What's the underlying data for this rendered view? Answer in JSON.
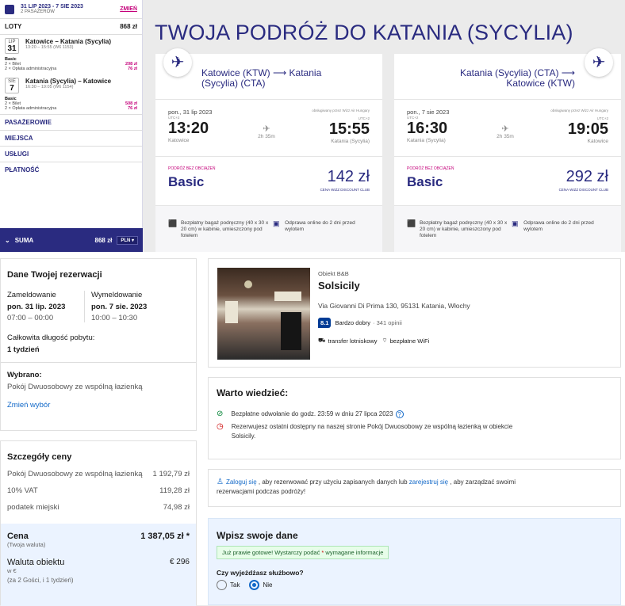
{
  "flight_summary": {
    "dates": "31 LIP 2023 - 7 SIE 2023",
    "passengers": "2 PASAŻERÓW",
    "change": "ZMIEŃ",
    "flights_label": "LOTY",
    "flights_total": "868 zł",
    "legs": [
      {
        "month": "LIP",
        "day": "31",
        "route": "Katowice – Katania (Sycylia)",
        "times": "13:20 – 15:55 (W6 1153)",
        "fare": "Basic",
        "items": [
          {
            "label": "2 × Bilet",
            "value": "208 zł"
          },
          {
            "label": "2 × Opłata administracyjna",
            "value": "76 zł"
          }
        ]
      },
      {
        "month": "SIE",
        "day": "7",
        "route": "Katania (Sycylia) – Katowice",
        "times": "16:30 – 19:05 (W6 1154)",
        "fare": "Basic",
        "items": [
          {
            "label": "2 × Bilet",
            "value": "508 zł"
          },
          {
            "label": "2 × Opłata administracyjna",
            "value": "76 zł"
          }
        ]
      }
    ],
    "sections": [
      "PASAŻEROWIE",
      "MIEJSCA",
      "USŁUGI",
      "PŁATNOŚĆ"
    ],
    "sum_label": "SUMA",
    "sum_value": "868 zł",
    "currency": "PLN"
  },
  "trip": {
    "title": "TWOJA PODRÓŻ DO KATANIA (SYCYLIA)",
    "cards": [
      {
        "route_a": "Katowice (KTW) ⟶ Katania",
        "route_b": "(Sycylia) (CTA)",
        "date": "pon., 31 lip 2023",
        "operator": "obsługiwany przez Wizz Air Hungary",
        "dep_utc": "UTC+2",
        "arr_utc": "UTC+2",
        "dep_time": "13:20",
        "arr_time": "15:55",
        "duration": "2h 35m",
        "dep_city": "Katowice",
        "arr_city": "Katania (Sycylia)",
        "fare_label": "PODRÓŻ BEZ OBCIĄŻEŃ",
        "fare_name": "Basic",
        "price": "142 zł",
        "club": "CENA WIZZ DISCOUNT CLUB",
        "bag": "Bezpłatny bagaż podręczny (40 x 30 x 20 cm) w kabinie, umieszczony pod fotelem",
        "checkin": "Odprawa online do 2 dni przed wylotem"
      },
      {
        "route_a": "Katania (Sycylia) (CTA) ⟶",
        "route_b": "Katowice (KTW)",
        "date": "pon., 7 sie 2023",
        "operator": "obsługiwany przez Wizz Air Hungary",
        "dep_utc": "UTC+2",
        "arr_utc": "UTC+2",
        "dep_time": "16:30",
        "arr_time": "19:05",
        "duration": "2h 35m",
        "dep_city": "Katania (Sycylia)",
        "arr_city": "Katowice",
        "fare_label": "PODRÓŻ BEZ OBCIĄŻEŃ",
        "fare_name": "Basic",
        "price": "292 zł",
        "club": "CENA WIZZ DISCOUNT CLUB",
        "bag": "Bezpłatny bagaż podręczny (40 x 30 x 20 cm) w kabinie, umieszczony pod fotelem",
        "checkin": "Odprawa online do 2 dni przed wylotem"
      }
    ]
  },
  "reservation": {
    "title": "Dane Twojej rezerwacji",
    "checkin_label": "Zameldowanie",
    "checkin_date": "pon. 31 lip. 2023",
    "checkin_time": "07:00 – 00:00",
    "checkout_label": "Wymeldowanie",
    "checkout_date": "pon. 7 sie. 2023",
    "checkout_time": "10:00 – 10:30",
    "length_label": "Całkowita długość pobytu:",
    "length_value": "1 tydzień",
    "selected_label": "Wybrano:",
    "selected_value": "Pokój Dwuosobowy ze wspólną łazienką",
    "change_link": "Zmień wybór"
  },
  "price": {
    "title": "Szczegóły ceny",
    "lines": [
      {
        "label": "Pokój Dwuosobowy ze wspólną łazienką",
        "value": "1 192,79 zł"
      },
      {
        "label": "10% VAT",
        "value": "119,28 zł"
      },
      {
        "label": "podatek miejski",
        "value": "74,98 zł"
      }
    ],
    "total_label": "Cena",
    "total_value": "1 387,05 zł *",
    "total_note": "(Twoja waluta)",
    "prop_label": "Waluta obiektu",
    "prop_value": "€ 296",
    "prop_cur": "w €",
    "prop_note": "(za 2 Gości, i 1 tydzień)"
  },
  "hotel": {
    "type": "Obiekt B&B",
    "name": "Solsicily",
    "address": "Via Giovanni Di Prima 130, 95131 Katania, Włochy",
    "score": "8.1",
    "rating": "Bardzo dobry",
    "reviews": "· 341 opinii",
    "amenity1": "transfer lotniskowy",
    "amenity2": "bezpłatne WiFi"
  },
  "info": {
    "title": "Warto wiedzieć:",
    "cancel": "Bezpłatne odwołanie do godz. 23:59 w dniu 27 lipca 2023",
    "last1": "Rezerwujesz ostatni dostępny na naszej stronie Pokój Dwuosobowy ze wspólną łazienką w obiekcie",
    "last2": "Solsicily."
  },
  "signin": {
    "login": "Zaloguj się",
    "mid": " , aby rezerwować przy użyciu zapisanych danych lub ",
    "register": "zarejestruj się",
    "end1": " , aby zarządzać swoimi",
    "end2": "rezerwacjami podczas podróży!"
  },
  "form": {
    "title": "Wpisz swoje dane",
    "notice_a": "Już prawie gotowe! Wystarczy podać ",
    "notice_star": "*",
    "notice_b": " wymagane informacje",
    "business_q": "Czy wyjeżdżasz służbowo?",
    "opt_yes": "Tak",
    "opt_no": "Nie"
  }
}
